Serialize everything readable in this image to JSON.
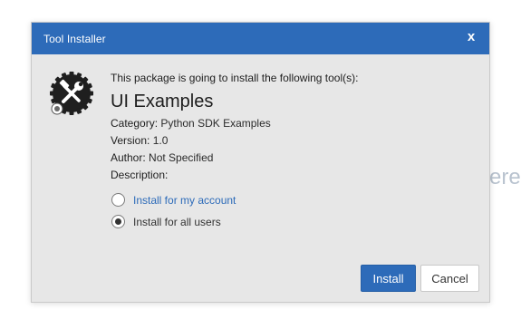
{
  "background": {
    "partial_text": "ere"
  },
  "dialog": {
    "title": "Tool Installer",
    "close_glyph": "x",
    "icon_name": "tools-wrench-hammer-icon",
    "intro": "This package is going to install the following tool(s):",
    "package_name": "UI Examples",
    "details": {
      "category_label": "Category:",
      "category_value": "Python SDK Examples",
      "version_label": "Version:",
      "version_value": "1.0",
      "author_label": "Author:",
      "author_value": "Not Specified",
      "description_label": "Description:",
      "description_value": ""
    },
    "options": [
      {
        "label": "Install for my account",
        "selected": false
      },
      {
        "label": "Install for all users",
        "selected": true
      }
    ],
    "buttons": {
      "install": "Install",
      "cancel": "Cancel"
    }
  },
  "colors": {
    "accent": "#2d6bb9",
    "dialog_bg": "#e7e7e7",
    "titlebar_text": "#ffffff"
  }
}
